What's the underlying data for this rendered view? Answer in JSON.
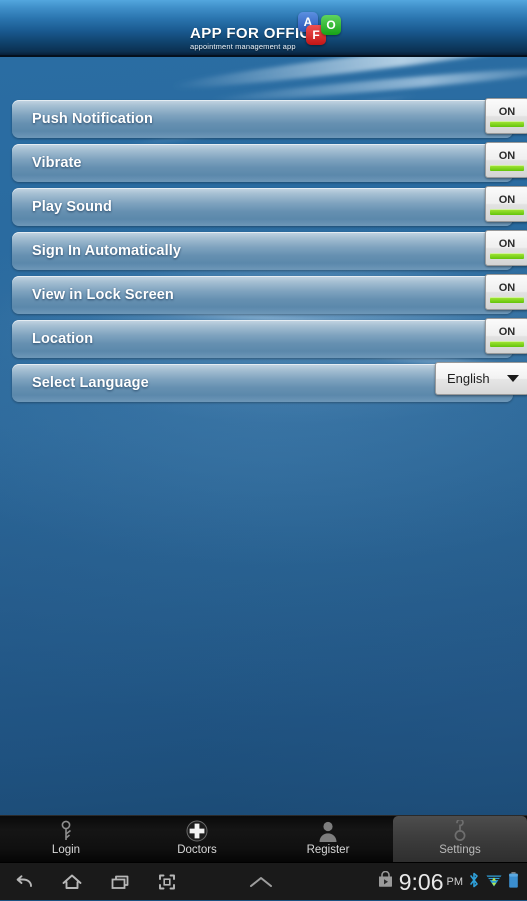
{
  "header": {
    "app_title": "APP FOR OFFICE",
    "tagline": "appointment management app",
    "logo_tiles": [
      {
        "letter": "A",
        "color": "#3b6ecc",
        "name": "logo-tile-a"
      },
      {
        "letter": "F",
        "color": "#d52a2a",
        "name": "logo-tile-f"
      },
      {
        "letter": "O",
        "color": "#2cb82c",
        "name": "logo-tile-o"
      }
    ]
  },
  "settings": {
    "rows": [
      {
        "label": "Push Notification",
        "control": "toggle",
        "value": "ON"
      },
      {
        "label": "Vibrate",
        "control": "toggle",
        "value": "ON"
      },
      {
        "label": "Play Sound",
        "control": "toggle",
        "value": "ON"
      },
      {
        "label": "Sign In Automatically",
        "control": "toggle",
        "value": "ON"
      },
      {
        "label": "View in Lock Screen",
        "control": "toggle",
        "value": "ON"
      },
      {
        "label": "Location",
        "control": "toggle",
        "value": "ON"
      },
      {
        "label": "Select Language",
        "control": "dropdown",
        "value": "English"
      }
    ]
  },
  "tabbar": {
    "tabs": [
      {
        "label": "Login",
        "icon": "key-icon",
        "active": false
      },
      {
        "label": "Doctors",
        "icon": "cross-icon",
        "active": false
      },
      {
        "label": "Register",
        "icon": "person-icon",
        "active": false
      },
      {
        "label": "Settings",
        "icon": "wrench-icon",
        "active": true
      }
    ]
  },
  "systembar": {
    "nav": [
      "back-icon",
      "home-icon",
      "recents-icon",
      "screenshot-icon",
      "chevron-up-icon"
    ],
    "time": "9:06",
    "ampm": "PM",
    "status_icons": [
      "play-store-icon",
      "bluetooth-icon",
      "wifi-icon",
      "battery-icon"
    ]
  },
  "colors": {
    "header_top": "#53a6de",
    "header_bottom": "#081f38",
    "wallpaper": "#2a6da3",
    "toggle_green": "#8fd820",
    "accent_blue": "#5b88ab"
  }
}
